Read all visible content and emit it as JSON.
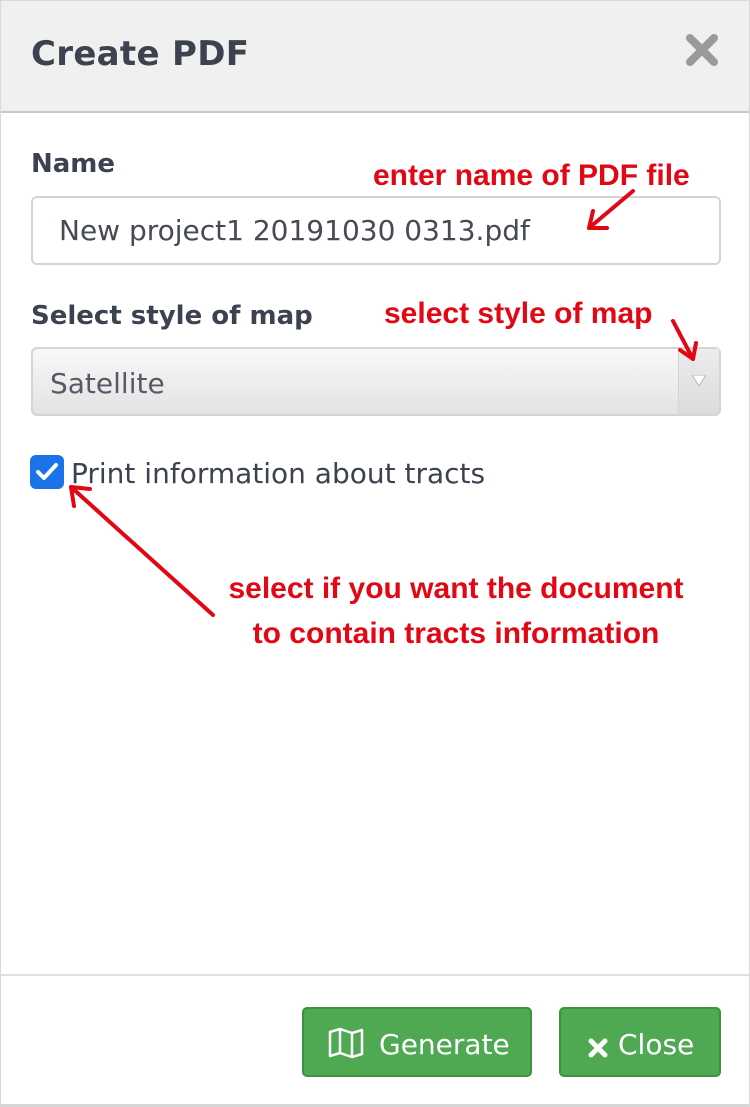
{
  "dialog": {
    "title": "Create PDF",
    "close_icon": "close-x-icon"
  },
  "form": {
    "name_label": "Name",
    "name_value": "New project1 20191030 0313.pdf",
    "style_label": "Select style of map",
    "style_selected": "Satellite",
    "tracts_label": "Print information about tracts",
    "tracts_checked": true
  },
  "annotations": {
    "name_hint": "enter name of PDF file",
    "style_hint": "select style of map",
    "tracts_hint_line1": "select if you want the document",
    "tracts_hint_line2": "to contain tracts information",
    "color": "#e30613"
  },
  "footer": {
    "generate_label": "Generate",
    "generate_icon": "map-icon",
    "close_label": "Close",
    "close_icon": "close-icon"
  },
  "colors": {
    "button_green": "#4fa852",
    "checkbox_blue": "#1a73e8",
    "header_bg": "#f0f0f0",
    "text_dark": "#3c4250"
  }
}
